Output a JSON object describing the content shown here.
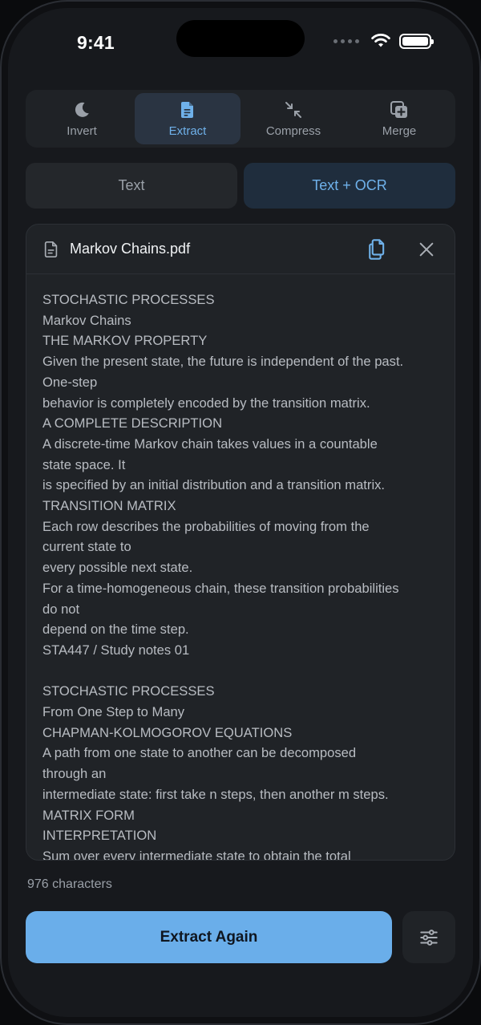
{
  "status_bar": {
    "time": "9:41"
  },
  "tools": [
    {
      "label": "Invert",
      "icon": "moon-icon",
      "active": false
    },
    {
      "label": "Extract",
      "icon": "document-icon",
      "active": true
    },
    {
      "label": "Compress",
      "icon": "compress-arrows-icon",
      "active": false
    },
    {
      "label": "Merge",
      "icon": "stack-plus-icon",
      "active": false
    }
  ],
  "modes": [
    {
      "label": "Text",
      "active": false
    },
    {
      "label": "Text + OCR",
      "active": true
    }
  ],
  "document": {
    "file_name": "Markov Chains.pdf",
    "lines": [
      "STOCHASTIC PROCESSES",
      "Markov Chains",
      "THE MARKOV PROPERTY",
      "Given the present state, the future is independent of the past.",
      "One-step",
      "behavior is completely encoded by the transition matrix.",
      "A COMPLETE DESCRIPTION",
      "A discrete-time Markov chain takes values in a countable",
      "state space. It",
      "is specified by an initial distribution and a transition matrix.",
      "TRANSITION MATRIX",
      "Each row describes the probabilities of moving from the",
      "current state to",
      "every possible next state.",
      "For a time-homogeneous chain, these transition probabilities",
      "do not",
      "depend on the time step.",
      "STA447 / Study notes 01",
      "",
      "STOCHASTIC PROCESSES",
      "From One Step to Many",
      "CHAPMAN-KOLMOGOROV EQUATIONS",
      "A path from one state to another can be decomposed",
      "through an",
      "intermediate state: first take n steps, then another m steps.",
      "MATRIX FORM",
      "INTERPRETATION",
      "Sum over every intermediate state to obtain the total"
    ]
  },
  "char_count": "976 characters",
  "actions": {
    "primary_label": "Extract Again"
  },
  "colors": {
    "accent": "#6aaeea",
    "background": "#17191d",
    "card": "#202327"
  }
}
